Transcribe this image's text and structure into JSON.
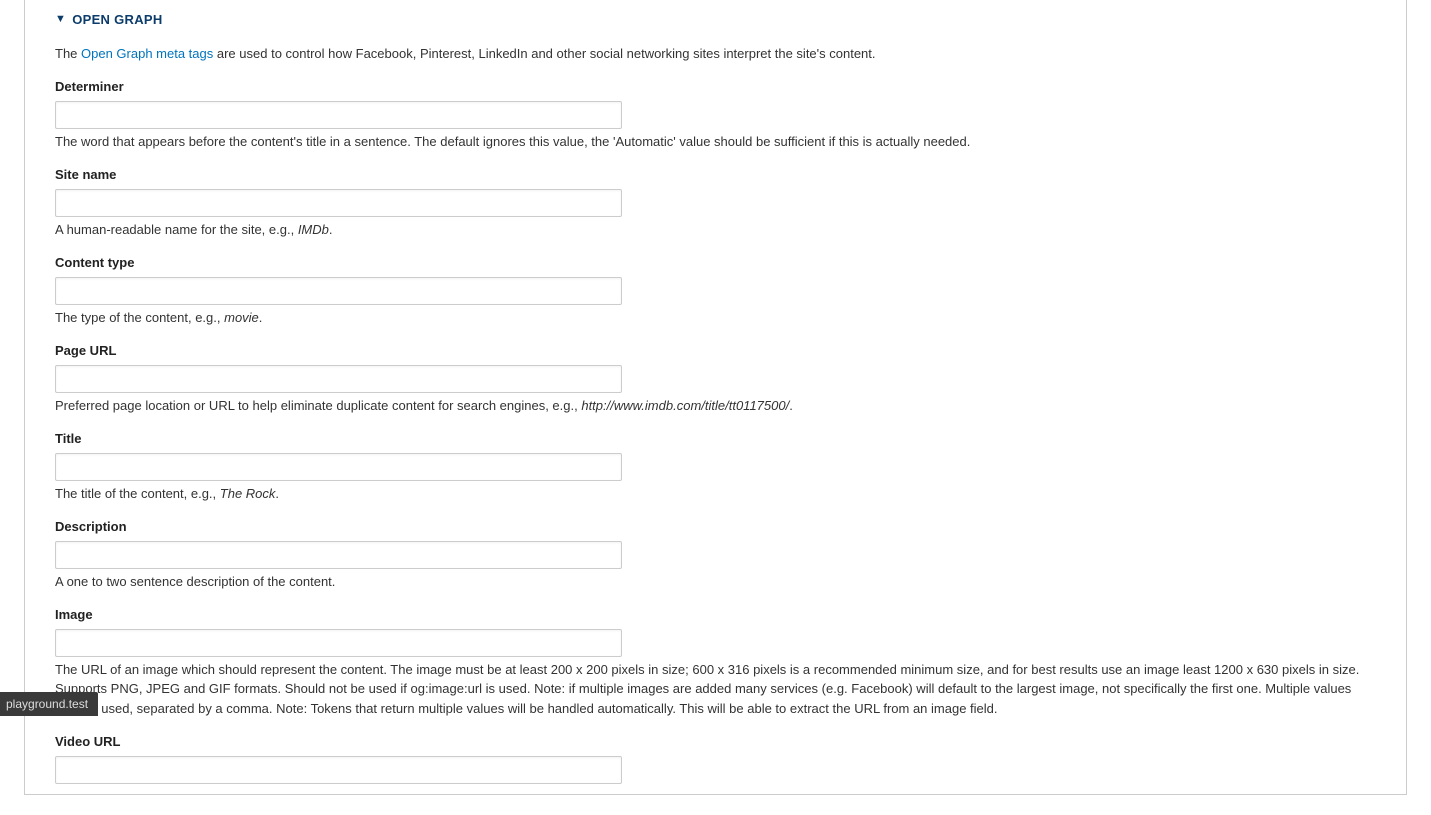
{
  "section": {
    "title": "OPEN GRAPH"
  },
  "intro": {
    "prefix": "The ",
    "link_text": "Open Graph meta tags",
    "suffix": " are used to control how Facebook, Pinterest, LinkedIn and other social networking sites interpret the site's content."
  },
  "fields": {
    "determiner": {
      "label": "Determiner",
      "value": "",
      "desc": "The word that appears before the content's title in a sentence. The default ignores this value, the 'Automatic' value should be sufficient if this is actually needed."
    },
    "site_name": {
      "label": "Site name",
      "value": "",
      "desc_prefix": "A human-readable name for the site, e.g., ",
      "desc_em": "IMDb",
      "desc_suffix": "."
    },
    "content_type": {
      "label": "Content type",
      "value": "",
      "desc_prefix": "The type of the content, e.g., ",
      "desc_em": "movie",
      "desc_suffix": "."
    },
    "page_url": {
      "label": "Page URL",
      "value": "",
      "desc_prefix": "Preferred page location or URL to help eliminate duplicate content for search engines, e.g., ",
      "desc_em": "http://www.imdb.com/title/tt0117500/",
      "desc_suffix": "."
    },
    "title": {
      "label": "Title",
      "value": "",
      "desc_prefix": "The title of the content, e.g., ",
      "desc_em": "The Rock",
      "desc_suffix": "."
    },
    "description": {
      "label": "Description",
      "value": "",
      "desc": "A one to two sentence description of the content."
    },
    "image": {
      "label": "Image",
      "value": "",
      "desc": "The URL of an image which should represent the content. The image must be at least 200 x 200 pixels in size; 600 x 316 pixels is a recommended minimum size, and for best results use an image least 1200 x 630 pixels in size. Supports PNG, JPEG and GIF formats. Should not be used if og:image:url is used. Note: if multiple images are added many services (e.g. Facebook) will default to the largest image, not specifically the first one. Multiple values may be used, separated by a comma. Note: Tokens that return multiple values will be handled automatically. This will be able to extract the URL from an image field."
    },
    "video_url": {
      "label": "Video URL",
      "value": ""
    }
  },
  "status_bar": "playground.test"
}
